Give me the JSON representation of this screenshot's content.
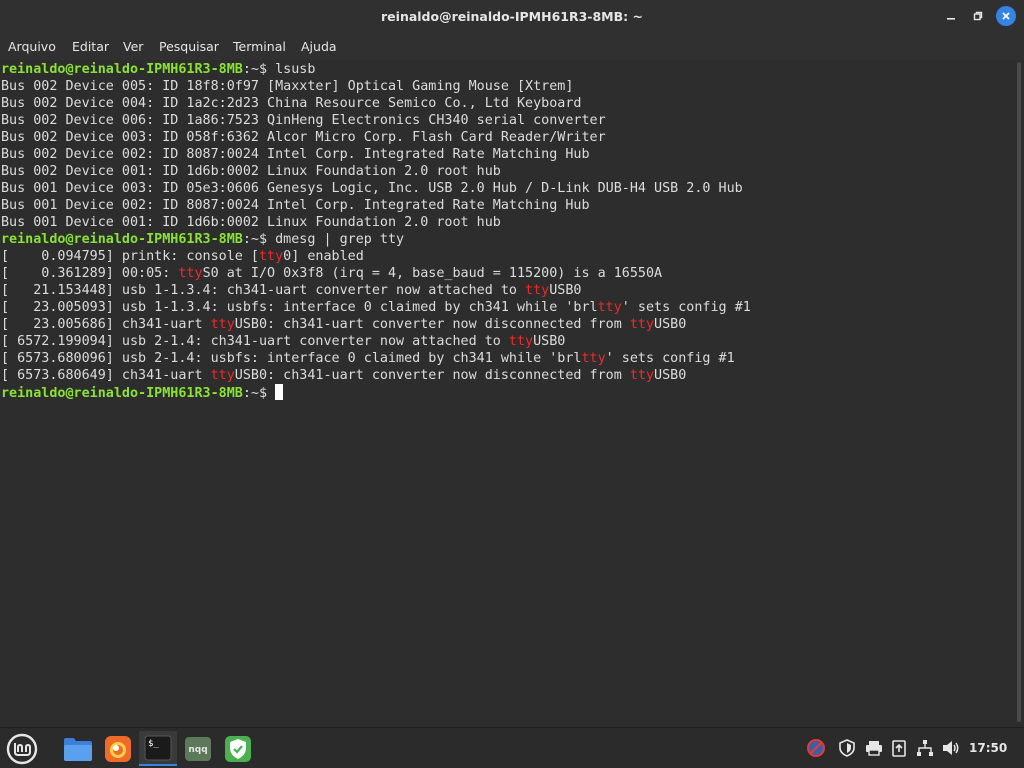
{
  "window": {
    "title": "reinaldo@reinaldo-IPMH61R3-8MB: ~"
  },
  "menu": {
    "items": [
      "Arquivo",
      "Editar",
      "Ver",
      "Pesquisar",
      "Terminal",
      "Ajuda"
    ]
  },
  "terminal": {
    "prompt_user": "reinaldo@reinaldo-IPMH61R3-8MB",
    "prompt_path": ":~$ ",
    "lines": [
      {
        "type": "prompt",
        "command": "lsusb"
      },
      {
        "type": "out",
        "text": "Bus 002 Device 005: ID 18f8:0f97 [Maxxter] Optical Gaming Mouse [Xtrem]"
      },
      {
        "type": "out",
        "text": "Bus 002 Device 004: ID 1a2c:2d23 China Resource Semico Co., Ltd Keyboard"
      },
      {
        "type": "out",
        "text": "Bus 002 Device 006: ID 1a86:7523 QinHeng Electronics CH340 serial converter"
      },
      {
        "type": "out",
        "text": "Bus 002 Device 003: ID 058f:6362 Alcor Micro Corp. Flash Card Reader/Writer"
      },
      {
        "type": "out",
        "text": "Bus 002 Device 002: ID 8087:0024 Intel Corp. Integrated Rate Matching Hub"
      },
      {
        "type": "out",
        "text": "Bus 002 Device 001: ID 1d6b:0002 Linux Foundation 2.0 root hub"
      },
      {
        "type": "out",
        "text": "Bus 001 Device 003: ID 05e3:0606 Genesys Logic, Inc. USB 2.0 Hub / D-Link DUB-H4 USB 2.0 Hub"
      },
      {
        "type": "out",
        "text": "Bus 001 Device 002: ID 8087:0024 Intel Corp. Integrated Rate Matching Hub"
      },
      {
        "type": "out",
        "text": "Bus 001 Device 001: ID 1d6b:0002 Linux Foundation 2.0 root hub"
      },
      {
        "type": "prompt",
        "command": "dmesg | grep tty"
      },
      {
        "type": "grep",
        "text": "[    0.094795] printk: console [tty0] enabled"
      },
      {
        "type": "grep",
        "text": "[    0.361289] 00:05: ttyS0 at I/O 0x3f8 (irq = 4, base_baud = 115200) is a 16550A"
      },
      {
        "type": "grep",
        "text": "[   21.153448] usb 1-1.3.4: ch341-uart converter now attached to ttyUSB0"
      },
      {
        "type": "grep",
        "text": "[   23.005093] usb 1-1.3.4: usbfs: interface 0 claimed by ch341 while 'brltty' sets config #1"
      },
      {
        "type": "grep",
        "text": "[   23.005686] ch341-uart ttyUSB0: ch341-uart converter now disconnected from ttyUSB0"
      },
      {
        "type": "grep",
        "text": "[ 6572.199094] usb 2-1.4: ch341-uart converter now attached to ttyUSB0"
      },
      {
        "type": "grep",
        "text": "[ 6573.680096] usb 2-1.4: usbfs: interface 0 claimed by ch341 while 'brltty' sets config #1"
      },
      {
        "type": "grep",
        "text": "[ 6573.680649] ch341-uart ttyUSB0: ch341-uart converter now disconnected from ttyUSB0"
      },
      {
        "type": "prompt_cursor",
        "command": ""
      }
    ],
    "highlight_term": "tty",
    "colors": {
      "prompt": "#8ae234",
      "highlight": "#ef2929",
      "text": "#dcdcdc",
      "background": "#2d2d2d"
    }
  },
  "taskbar": {
    "apps": [
      {
        "name": "menu",
        "icon": "linux-mint-logo-icon",
        "active": false
      },
      {
        "name": "files",
        "icon": "folder-icon",
        "active": false
      },
      {
        "name": "firefox",
        "icon": "firefox-icon",
        "active": false
      },
      {
        "name": "terminal",
        "icon": "terminal-icon",
        "active": true
      },
      {
        "name": "nqq",
        "icon": "notepadqq-icon",
        "active": false,
        "label": "nqq"
      },
      {
        "name": "update",
        "icon": "shield-check-icon",
        "active": false
      }
    ],
    "tray": [
      "network-blocked-icon",
      "shield-icon",
      "printer-icon",
      "clipboard-icon",
      "network-icon",
      "volume-icon"
    ],
    "clock": "17:50"
  }
}
